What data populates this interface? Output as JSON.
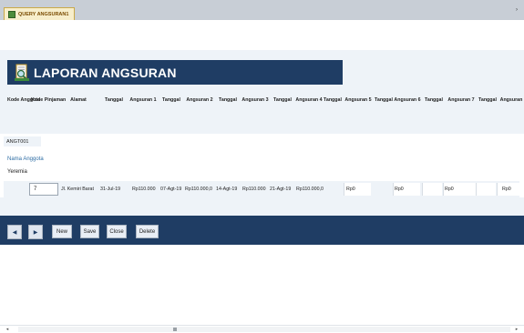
{
  "tab": {
    "title": "QUERY ANGSURAN1"
  },
  "form": {
    "title": "LAPORAN ANGSURAN"
  },
  "columns": [
    {
      "label": "Kode Anggota"
    },
    {
      "label": "Kode Pinjaman"
    },
    {
      "label": "Alamat"
    },
    {
      "label": "Tanggal"
    },
    {
      "label": "Angsuran 1"
    },
    {
      "label": "Tanggal"
    },
    {
      "label": "Angsuran 2"
    },
    {
      "label": "Tanggal"
    },
    {
      "label": "Angsuran 3"
    },
    {
      "label": "Tanggal"
    },
    {
      "label": "Angsuran 4"
    },
    {
      "label": "Tanggal"
    },
    {
      "label": "Angsuran 5"
    },
    {
      "label": "Tanggal"
    },
    {
      "label": "Angsuran 6"
    },
    {
      "label": "Tanggal"
    },
    {
      "label": "Angsuran 7"
    },
    {
      "label": "Tanggal"
    },
    {
      "label": "Angsuran"
    }
  ],
  "record": {
    "kode_anggota": "ANGT001",
    "nama_label": "Nama Anggota",
    "nama": "Yeremia",
    "kode_pinjaman": "7",
    "alamat": "Jl. Kemiri Barat",
    "tanggal": "31-Jul-19",
    "angsuran1": "Rp110.000",
    "tanggal1": "07-Agt-19",
    "angsuran2": "Rp110.000,0",
    "tanggal2": "14-Agt-19",
    "angsuran3": "Rp110.000",
    "tanggal3": "21-Agt-19",
    "angsuran4": "Rp110.000,0",
    "angsuran5": "Rp0",
    "angsuran6": "Rp0",
    "angsuran7": "Rp0",
    "angsuran8": "Rp0"
  },
  "nav": {
    "prev_icon": "◀",
    "next_icon": "▶",
    "new_label": "New",
    "save_label": "Save",
    "close_label": "Close",
    "delete_label": "Delete"
  },
  "icons": {
    "form_icon": "report-magnifier-icon",
    "tab_icon": "query-table-icon"
  },
  "colors": {
    "title_bar": "#1f3d64",
    "band": "#eef3f8",
    "link_text": "#2e6da4"
  }
}
